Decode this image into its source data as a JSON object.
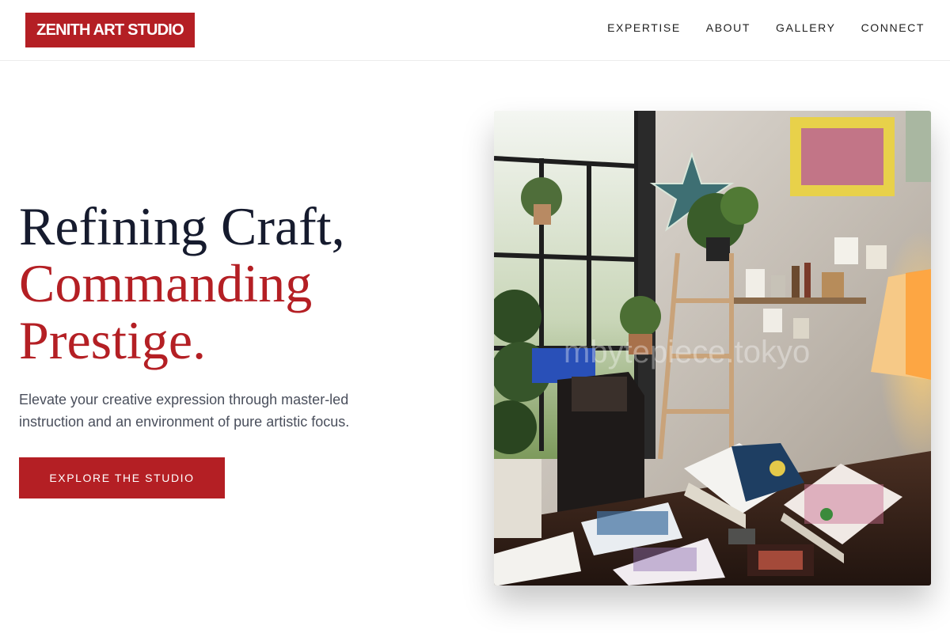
{
  "header": {
    "logo_text": "ZENITH ART STUDIO",
    "nav": [
      {
        "label": "EXPERTISE"
      },
      {
        "label": "ABOUT"
      },
      {
        "label": "GALLERY"
      },
      {
        "label": "CONNECT"
      }
    ]
  },
  "hero": {
    "title_line1": "Refining Craft,",
    "title_line2": "Commanding",
    "title_line3": "Prestige.",
    "subtitle": "Elevate your creative expression through master-led instruction and an environment of pure artistic focus.",
    "cta_label": "EXPLORE THE STUDIO",
    "image_watermark": "mbytepiece.tokyo"
  },
  "colors": {
    "brand": "#b41f24",
    "heading": "#161b2e",
    "body_text": "#4a4f5c",
    "background": "#ffffff"
  }
}
